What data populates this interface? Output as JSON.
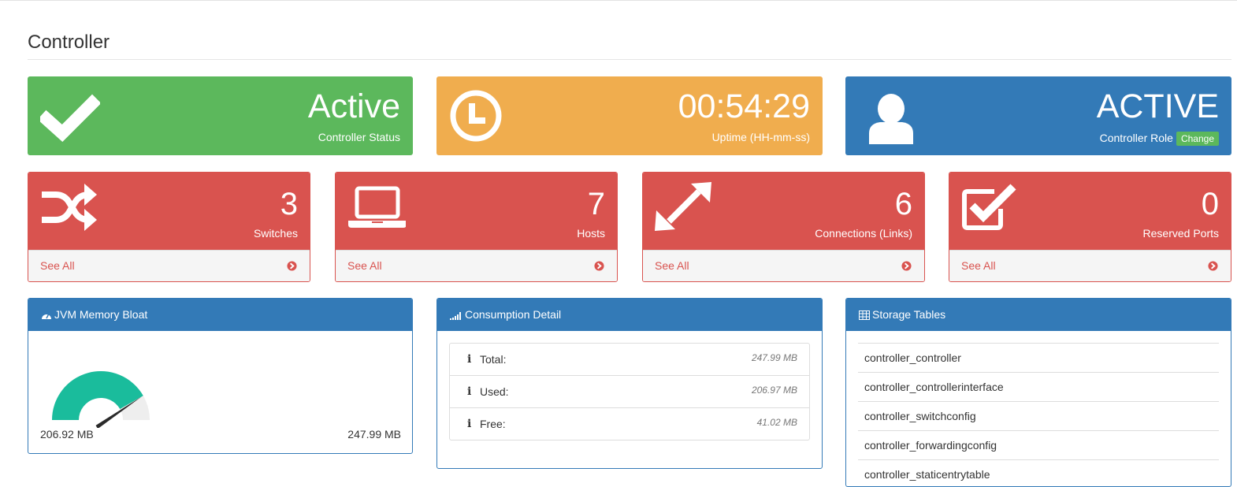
{
  "page": {
    "title": "Controller"
  },
  "status_panels": [
    {
      "value": "Active",
      "label": "Controller Status",
      "icon": "check-icon",
      "color": "#5cb85c"
    },
    {
      "value": "00:54:29",
      "label": "Uptime (HH-mm-ss)",
      "icon": "clock-icon",
      "color": "#f0ad4e"
    },
    {
      "value": "ACTIVE",
      "label": "Controller Role",
      "button": "Change",
      "icon": "user-icon",
      "color": "#337ab7"
    }
  ],
  "count_panels": [
    {
      "value": "3",
      "label": "Switches",
      "link": "See All",
      "icon": "shuffle-icon"
    },
    {
      "value": "7",
      "label": "Hosts",
      "link": "See All",
      "icon": "laptop-icon"
    },
    {
      "value": "6",
      "label": "Connections (Links)",
      "link": "See All",
      "icon": "expand-arrows-icon"
    },
    {
      "value": "0",
      "label": "Reserved Ports",
      "link": "See All",
      "icon": "checkbox-icon"
    }
  ],
  "memory": {
    "title": "JVM Memory Bloat",
    "used": "206.92 MB",
    "total": "247.99 MB",
    "used_fraction": 0.834,
    "gauge_color": "#1abc9c"
  },
  "consumption": {
    "title": "Consumption Detail",
    "rows": [
      {
        "label": "Total:",
        "value": "247.99 MB"
      },
      {
        "label": "Used:",
        "value": "206.97 MB"
      },
      {
        "label": "Free:",
        "value": "41.02 MB"
      }
    ]
  },
  "storage": {
    "title": "Storage Tables",
    "items": [
      "controller_controller",
      "controller_controllerinterface",
      "controller_switchconfig",
      "controller_forwardingconfig",
      "controller_staticentrytable"
    ]
  },
  "colors": {
    "danger": "#d9534f",
    "primary": "#337ab7",
    "success": "#5cb85c",
    "warning": "#f0ad4e"
  }
}
